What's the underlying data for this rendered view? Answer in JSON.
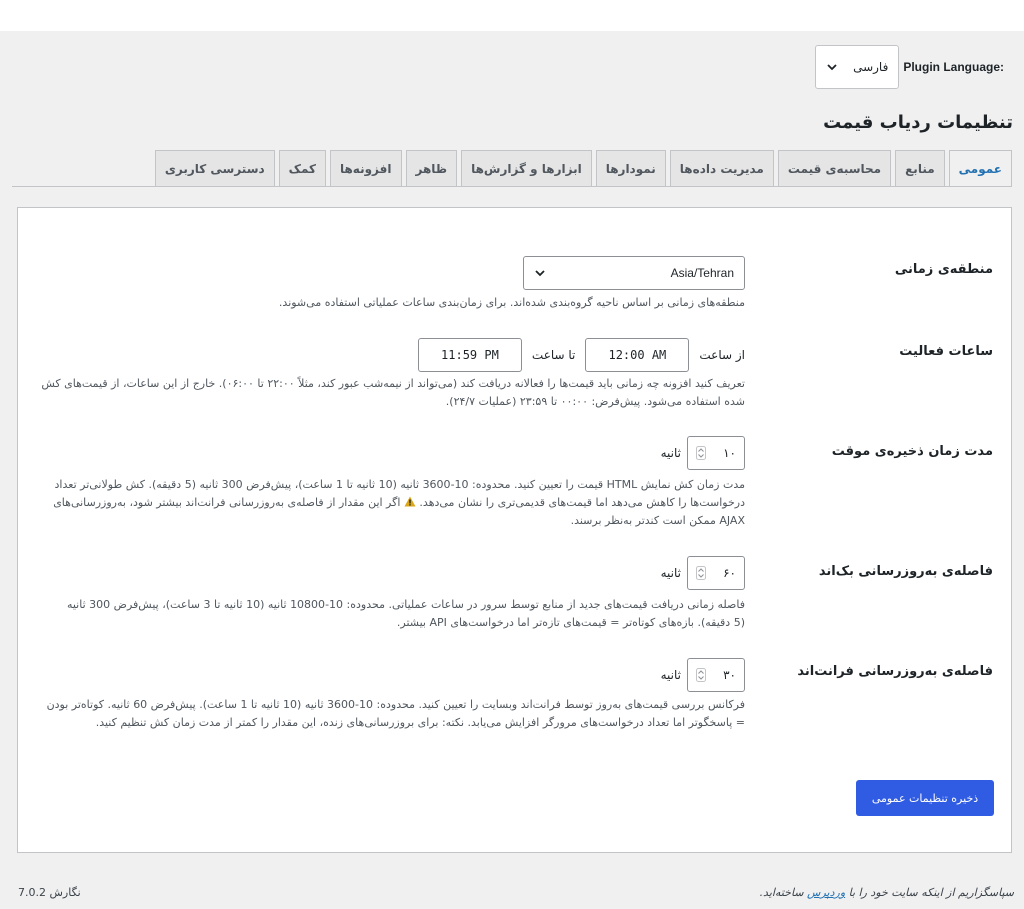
{
  "header": {
    "language_label": "Plugin Language:",
    "language_value": "فارسی"
  },
  "page": {
    "title": "تنظیمات ردیاب قیمت"
  },
  "tabs": [
    {
      "label": "عمومی",
      "active": true
    },
    {
      "label": "منابع"
    },
    {
      "label": "محاسبه‌ی قیمت"
    },
    {
      "label": "مدیریت داده‌ها"
    },
    {
      "label": "نمودارها"
    },
    {
      "label": "ابزارها و گزارش‌ها"
    },
    {
      "label": "ظاهر"
    },
    {
      "label": "افزونه‌ها"
    },
    {
      "label": "کمک"
    },
    {
      "label": "دسترسی کاربری"
    }
  ],
  "settings": {
    "timezone": {
      "label": "منطقه‌ی زمانی",
      "value": "Asia/Tehran",
      "desc": "منطقه‌های زمانی بر اساس ناحیه گروه‌بندی شده‌اند. برای زمان‌بندی ساعات عملیاتی استفاده می‌شوند."
    },
    "hours": {
      "label": "ساعات فعالیت",
      "from_label": "از ساعت",
      "from_value": "12:00 AM",
      "to_label": "تا ساعت",
      "to_value": "11:59 PM",
      "desc": "تعریف کنید افزونه چه زمانی باید قیمت‌ها را فعالانه دریافت کند (می‌تواند از نیمه‌شب عبور کند، مثلاً ۲۲:۰۰ تا ۰۶:۰۰). خارج از این ساعات، از قیمت‌های کش شده استفاده می‌شود. پیش‌فرض: ۰۰:۰۰ تا ۲۳:۵۹ (عملیات ۲۴/۷)."
    },
    "cache": {
      "label": "مدت زمان ذخیره‌ی موقت",
      "value": "۱۰",
      "unit": "ثانیه",
      "desc_1": "مدت زمان کش نمایش HTML قیمت را تعیین کنید. محدوده: 10-3600 ثانیه (10 ثانیه تا 1 ساعت)، پیش‌فرض 300 ثانیه (5 دقیقه). کش طولانی‌تر تعداد درخواست‌ها را کاهش می‌دهد اما قیمت‌های قدیمی‌تری را نشان می‌دهد.",
      "warn_icon": "warning-icon",
      "desc_2": "اگر این مقدار از فاصله‌ی به‌روزرسانی فرانت‌اند بیشتر شود، به‌روزرسانی‌های AJAX ممکن است کندتر به‌نظر برسند."
    },
    "backend_refresh": {
      "label": "فاصله‌ی به‌روزرسانی بک‌اند",
      "value": "۶۰",
      "unit": "ثانیه",
      "desc": "فاصله زمانی دریافت قیمت‌های جدید از منابع توسط سرور در ساعات عملیاتی. محدوده: 10-10800 ثانیه (10 ثانیه تا 3 ساعت)، پیش‌فرض 300 ثانیه (5 دقیقه). بازه‌های کوتاه‌تر = قیمت‌های تازه‌تر اما درخواست‌های API بیشتر."
    },
    "frontend_refresh": {
      "label": "فاصله‌ی به‌روزرسانی فرانت‌اند",
      "value": "۳۰",
      "unit": "ثانیه",
      "desc": "فرکانس بررسی قیمت‌های به‌روز توسط فرانت‌اند وبسایت را تعیین کنید. محدوده: 10-3600 ثانیه (10 ثانیه تا 1 ساعت). پیش‌فرض 60 ثانیه. کوتاه‌تر بودن = پاسخگوتر اما تعداد درخواست‌های مرورگر افزایش می‌یابد. نکته: برای بروزرسانی‌های زنده، این مقدار را کمتر از مدت زمان کش تنظیم کنید."
    }
  },
  "save_label": "ذخیره تنظیمات عمومی",
  "footer": {
    "thanks_before": "سپاسگزاریم از اینکه سایت خود را با",
    "thanks_link": "وردپرس",
    "thanks_after": "ساخته‌اید.",
    "version": "نگارش 7.0.2"
  },
  "colors": {
    "accent": "#2271b1",
    "button": "#2f5ce3",
    "warning": "#dba617"
  }
}
